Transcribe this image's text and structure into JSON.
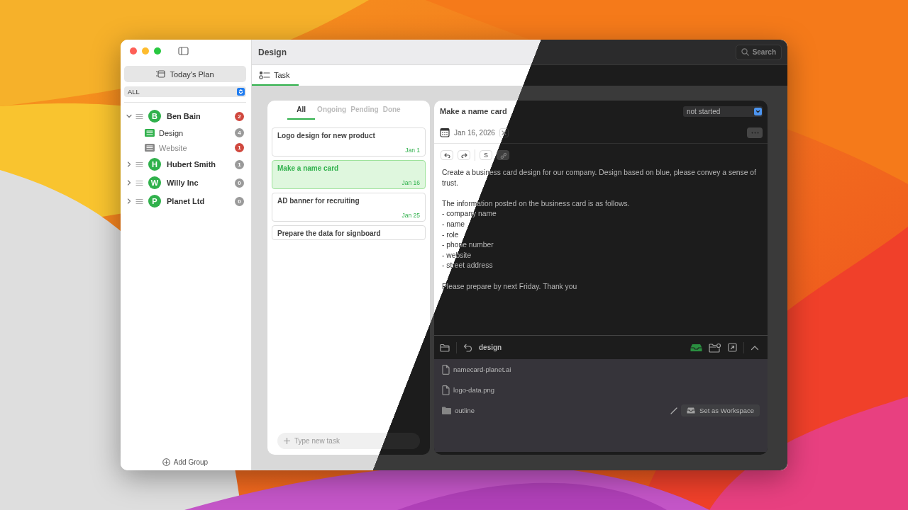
{
  "window": {
    "title": "Design"
  },
  "search": {
    "label": "Search"
  },
  "sidebar": {
    "today_button": "Today's Plan",
    "filter": "ALL",
    "groups": [
      {
        "initial": "B",
        "name": "Ben Bain",
        "count": "2",
        "overdue": true,
        "expanded": true,
        "children": [
          {
            "name": "Design",
            "count": "4",
            "overdue": false,
            "selected": true
          },
          {
            "name": "Website",
            "count": "1",
            "overdue": true,
            "selected": false
          }
        ]
      },
      {
        "initial": "H",
        "name": "Hubert Smith",
        "count": "1",
        "overdue": false,
        "expanded": false
      },
      {
        "initial": "W",
        "name": "Willy Inc",
        "count": "0",
        "overdue": false,
        "expanded": false
      },
      {
        "initial": "P",
        "name": "Planet Ltd",
        "count": "0",
        "overdue": false,
        "expanded": false
      }
    ],
    "add_group": "Add Group"
  },
  "tabs": [
    {
      "label": "Task",
      "selected": true
    }
  ],
  "task_list": {
    "filters": [
      {
        "label": "All",
        "selected": true
      },
      {
        "label": "Ongoing",
        "selected": false
      },
      {
        "label": "Pending",
        "selected": false
      },
      {
        "label": "Done",
        "selected": false
      }
    ],
    "tasks": [
      {
        "title": "Logo design for new product",
        "due": "Jan 1",
        "selected": false
      },
      {
        "title": "Make a name card",
        "due": "Jan 16",
        "selected": true
      },
      {
        "title": "AD banner for recruiting",
        "due": "Jan 25",
        "selected": false
      },
      {
        "title": "Prepare the data for signboard",
        "selected": false
      }
    ],
    "new_task": {
      "placeholder": "Type new task"
    }
  },
  "detail": {
    "title": "Make a name card",
    "status": "not started",
    "due_date": "Jan 16, 2026",
    "strike_label": "S",
    "paragraphs": [
      {
        "lines": [
          "Create a business card design for our company. Design based on blue, please convey a sense of trust."
        ]
      },
      {
        "lines": [
          "The information posted on the business card is as follows.",
          "- company name",
          "- name",
          "- role",
          "- phone number",
          "- website",
          "- street address"
        ]
      },
      {
        "lines": [
          "Please prepare by next Friday. Thank you"
        ]
      }
    ],
    "folder": {
      "name": "design",
      "items": [
        {
          "name": "namecard-planet.ai",
          "kind": "file"
        },
        {
          "name": "logo-data.png",
          "kind": "file"
        },
        {
          "name": "outline",
          "kind": "folder"
        }
      ]
    },
    "workspace_button": "Set as Workspace"
  }
}
